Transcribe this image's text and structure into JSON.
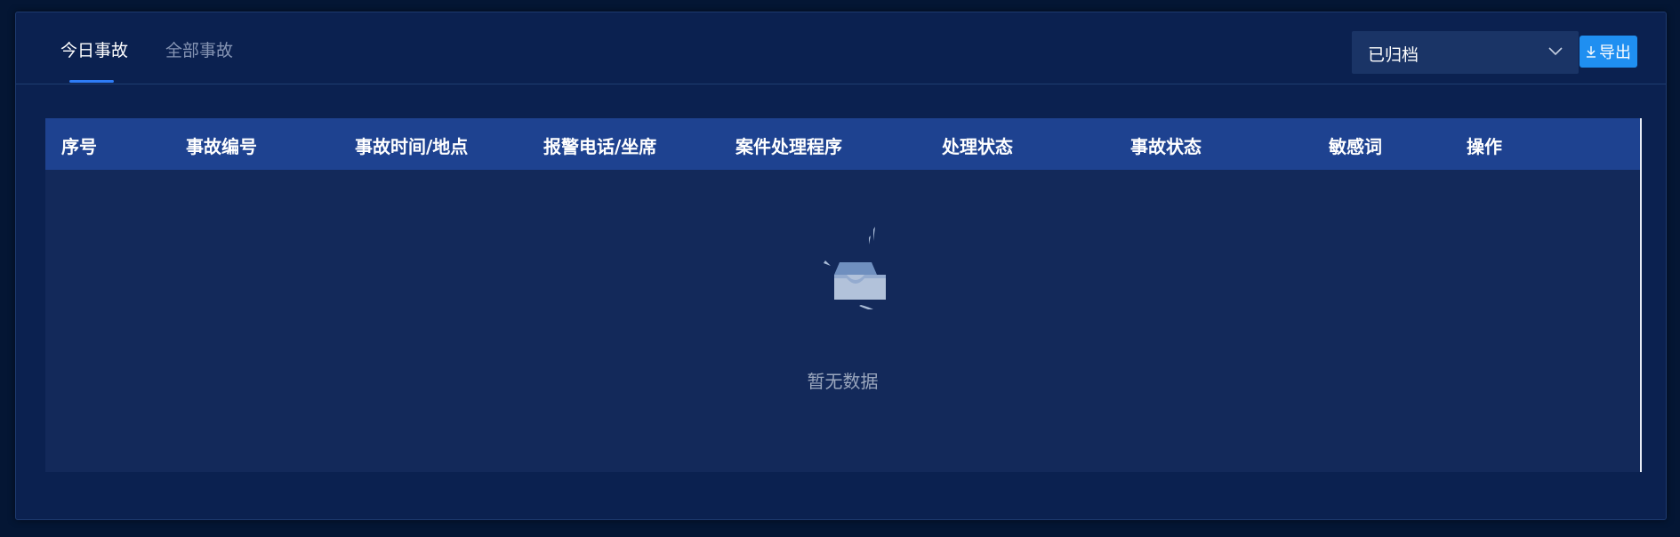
{
  "tabs": [
    {
      "label": "今日事故",
      "active": true
    },
    {
      "label": "全部事故",
      "active": false
    }
  ],
  "filter": {
    "selected": "已归档"
  },
  "export_button": {
    "label": "导出"
  },
  "table": {
    "columns": [
      "序号",
      "事故编号",
      "事故时间/地点",
      "报警电话/坐席",
      "案件处理程序",
      "处理状态",
      "事故状态",
      "敏感词",
      "操作"
    ],
    "rows": [],
    "empty_text": "暂无数据"
  },
  "colors": {
    "background": "#041634",
    "panel": "#0b2150",
    "header": "#1e4290",
    "accent": "#1f8ff1"
  }
}
